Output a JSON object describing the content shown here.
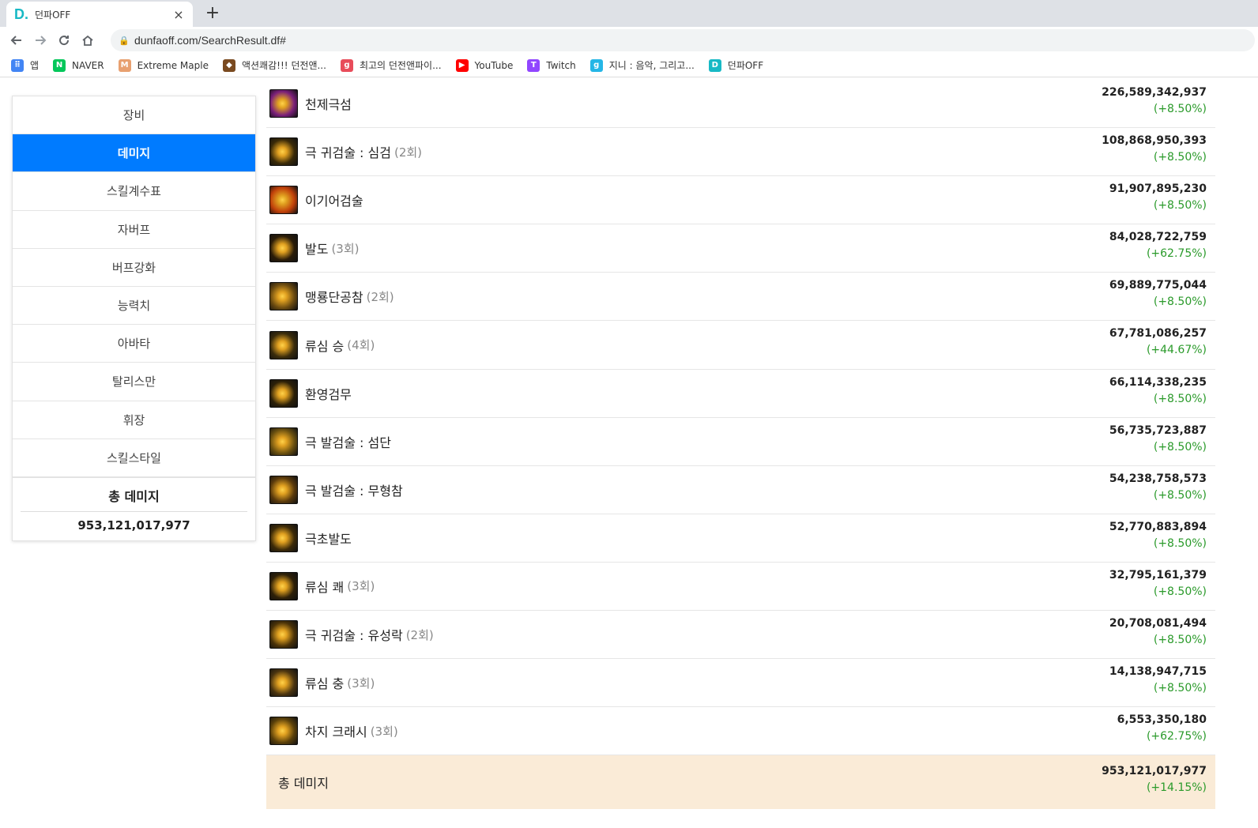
{
  "browser": {
    "tab_title": "던파OFF",
    "tab_favicon": "D.",
    "url": "dunfaoff.com/SearchResult.df#",
    "bookmarks": [
      {
        "label": "앱",
        "icon": "apps-grid-icon",
        "color": "#4285f4",
        "glyph": "⠿"
      },
      {
        "label": "NAVER",
        "icon": "naver-icon",
        "color": "#03c75a",
        "glyph": "N"
      },
      {
        "label": "Extreme Maple",
        "icon": "maple-icon",
        "color": "#e8a070",
        "glyph": "M"
      },
      {
        "label": "액션쾌감!!! 던전앤...",
        "icon": "dnf-icon",
        "color": "#7a4a20",
        "glyph": "◆"
      },
      {
        "label": "최고의 던전앤파이...",
        "icon": "g-icon",
        "color": "#e84c5a",
        "glyph": "g"
      },
      {
        "label": "YouTube",
        "icon": "youtube-icon",
        "color": "#ff0000",
        "glyph": "▶"
      },
      {
        "label": "Twitch",
        "icon": "twitch-icon",
        "color": "#9146ff",
        "glyph": "T"
      },
      {
        "label": "지니 : 음악, 그리고...",
        "icon": "genie-icon",
        "color": "#25b6e6",
        "glyph": "g"
      },
      {
        "label": "던파OFF",
        "icon": "dunfaoff-icon",
        "color": "#18b9c5",
        "glyph": "D"
      }
    ]
  },
  "sidebar": {
    "items": [
      "장비",
      "데미지",
      "스킬계수표",
      "자버프",
      "버프강화",
      "능력치",
      "아바타",
      "탈리스만",
      "휘장",
      "스킬스타일"
    ],
    "active_index": 1,
    "total_label": "총 데미지",
    "total_value": "953,121,017,977"
  },
  "skills": [
    {
      "name": "천제극섬",
      "count": "",
      "damage": "226,589,342,937",
      "pct": "(+8.50%)",
      "icon_color": "#7a1f7a"
    },
    {
      "name": "극 귀검술 : 심검",
      "count": "(2회)",
      "damage": "108,868,950,393",
      "pct": "(+8.50%)",
      "icon_color": "#3a2a08"
    },
    {
      "name": "이기어검술",
      "count": "",
      "damage": "91,907,895,230",
      "pct": "(+8.50%)",
      "icon_color": "#c0400a"
    },
    {
      "name": "발도",
      "count": "(3회)",
      "damage": "84,028,722,759",
      "pct": "(+62.75%)",
      "icon_color": "#2a1c08"
    },
    {
      "name": "맹룡단공참",
      "count": "(2회)",
      "damage": "69,889,775,044",
      "pct": "(+8.50%)",
      "icon_color": "#6a4a10"
    },
    {
      "name": "류심 승",
      "count": "(4회)",
      "damage": "67,781,086,257",
      "pct": "(+44.67%)",
      "icon_color": "#3a2c0c"
    },
    {
      "name": "환영검무",
      "count": "",
      "damage": "66,114,338,235",
      "pct": "(+8.50%)",
      "icon_color": "#2c2008"
    },
    {
      "name": "극 발검술 : 섬단",
      "count": "",
      "damage": "56,735,723,887",
      "pct": "(+8.50%)",
      "icon_color": "#6a5010"
    },
    {
      "name": "극 발검술 : 무형참",
      "count": "",
      "damage": "54,238,758,573",
      "pct": "(+8.50%)",
      "icon_color": "#5a3a0c"
    },
    {
      "name": "극초발도",
      "count": "",
      "damage": "52,770,883,894",
      "pct": "(+8.50%)",
      "icon_color": "#3c2a08"
    },
    {
      "name": "류심 쾌",
      "count": "(3회)",
      "damage": "32,795,161,379",
      "pct": "(+8.50%)",
      "icon_color": "#2e2008"
    },
    {
      "name": "극 귀검술 : 유성락",
      "count": "(2회)",
      "damage": "20,708,081,494",
      "pct": "(+8.50%)",
      "icon_color": "#4a3208"
    },
    {
      "name": "류심 충",
      "count": "(3회)",
      "damage": "14,138,947,715",
      "pct": "(+8.50%)",
      "icon_color": "#4a3410"
    },
    {
      "name": "차지 크래시",
      "count": "(3회)",
      "damage": "6,553,350,180",
      "pct": "(+62.75%)",
      "icon_color": "#5a400a"
    }
  ],
  "total_row": {
    "label": "총 데미지",
    "damage": "953,121,017,977",
    "pct": "(+14.15%)"
  }
}
